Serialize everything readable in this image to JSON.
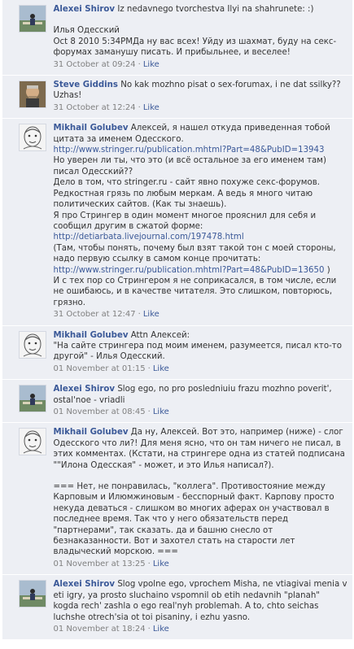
{
  "like_label": "Like",
  "dot": "·",
  "comments": [
    {
      "author": "Alexei Shirov",
      "avatar": "chess-player-photo",
      "text": [
        "Iz nedavnego tvorchestva Ilyi na shahrunete: :)",
        "",
        "Илья Одесский",
        "Oct 8 2010 5:34PMДа ну вас всех! Уйду из шахмат, буду на секс-форумах заманушу писать. И прибыльнее, и веселее!"
      ],
      "time": "31 October at 09:24"
    },
    {
      "author": "Steve Giddins",
      "avatar": "man-portrait-photo",
      "text": [
        "No kak mozhno pisat o sex-forumax, i ne dat ssilky?? Uzhas!"
      ],
      "time": "31 October at 12:24"
    },
    {
      "author": "Mikhail Golubev",
      "avatar": "cartoon-portrait",
      "text": [
        "Алексей, я нашел откуда приведенная тобой цитата за именем Одесского.",
        {
          "link": "http://www.stringer.ru/publication.mhtml?Part=48&PubID=13943"
        },
        "Но уверен ли ты, что это (и всё остальное за его именем там) писал Одесский??",
        "Дело в том, что stringer.ru - сайт явно похуже секс-форумов. Редкостная грязь по любым меркам. А ведь я много читаю политических сайтов. (Как ты знаешь).",
        "Я про Стрингер в один момент многое прояснил для себя и сообщил другим в сжатой форме:",
        {
          "link": "http://detiarbata.livejournal.com/197478.html"
        },
        "(Там, чтобы понять, почему был взят такой тон с моей стороны, надо первую ссылку в самом конце прочитать:",
        {
          "link": "http://www.stringer.ru/publication.mhtml?Part=48&PubID=13650",
          "suffix": " )"
        },
        "И с тех пор со Стрингером я не соприкасался, в том числе, если не ошибаюсь, и в качестве читателя. Это слишком, повторюсь, грязно."
      ],
      "time": "31 October at 12:47"
    },
    {
      "author": "Mikhail Golubev",
      "avatar": "cartoon-portrait",
      "text": [
        "Attn Алексей:",
        "\"На сайте стрингера под моим именем, разумеется, писал кто-то другой\" - Илья Одесский."
      ],
      "time": "01 November at 01:15"
    },
    {
      "author": "Alexei Shirov",
      "avatar": "chess-player-photo",
      "text": [
        "Slog ego, no pro posledniuiu frazu mozhno poverit', ostal'noe - vriadli"
      ],
      "time": "01 November at 08:45"
    },
    {
      "author": "Mikhail Golubev",
      "avatar": "cartoon-portrait",
      "text": [
        "Да ну, Алексей. Вот это, например (ниже) - слог Одесского что ли?! Для меня ясно, что он там ничего не писал, в этих комментах. (Кстати, на стрингере одна из статей подписана \"\"Илона Одесская\" - может, и это Илья написал?).",
        "",
        "=== Нет, не понравилась, \"коллега\". Противостояние между Карповым и Илюмжиновым - бесспорный факт. Карпову просто некуда деваться - слишком во многих аферах он участвовал в последнее время. Так что у него обязательств перед \"партнерами\", так сказать. да и башню снесло от безнаказанности. Вот и захотел стать на старости лет владыческий морскою. ==="
      ],
      "time": "01 November at 13:25"
    },
    {
      "author": "Alexei Shirov",
      "avatar": "chess-player-photo",
      "text": [
        "Slog vpolne ego, vprochem Misha, ne vtiagivai menia v eti igry, ya prosto sluchaino vspomnil ob etih nedavnih \"planah\" kogda rech' zashla o ego real'nyh problemah. A to, chto seichas luchshe otrech'sia ot toi pisaniny, i ezhu yasno."
      ],
      "time": "01 November at 18:24"
    }
  ]
}
